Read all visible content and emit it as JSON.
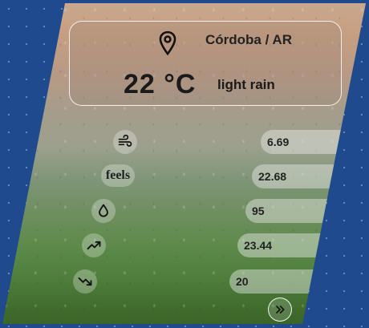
{
  "location": {
    "text": "Córdoba / AR",
    "icon": "location-pin-icon"
  },
  "current": {
    "temperature": "22 °C",
    "description": "light rain"
  },
  "stats": [
    {
      "name": "wind",
      "icon": "wind-icon",
      "value": "6.69"
    },
    {
      "name": "feels",
      "label": "feels",
      "value": "22.68"
    },
    {
      "name": "humidity",
      "icon": "droplet-icon",
      "value": "95"
    },
    {
      "name": "max-temp",
      "icon": "trend-up-icon",
      "value": "23.44"
    },
    {
      "name": "min-temp",
      "icon": "trend-down-icon",
      "value": "20"
    }
  ],
  "more_button": {
    "icon": "double-chevron-right-icon"
  },
  "colors": {
    "background": "#1f4b8e",
    "text": "#222222"
  }
}
